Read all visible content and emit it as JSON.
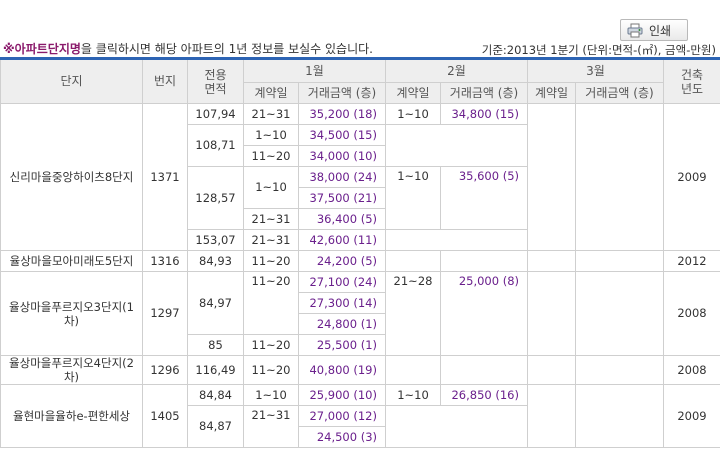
{
  "header": {
    "print_label": "인쇄",
    "notice_highlight": "※아파트단지명",
    "notice_rest": "을 클릭하시면 해당 아파트의 1년 정보를 보실수 있습니다.",
    "basis": "기준:2013년 1분기   (단위:면적-(㎡), 금액-만원)"
  },
  "table": {
    "headers": {
      "complex": "단지",
      "lot": "번지",
      "area": "전용면적",
      "built": "건축년도",
      "months": [
        "1월",
        "2월",
        "3월"
      ],
      "contract_date": "계약일",
      "amount": "거래금액 (층)"
    },
    "complexes": [
      {
        "name": "신리마을중앙하이츠8단지",
        "lot": "1371",
        "built": "2009"
      },
      {
        "name": "율상마을모아미래도5단지",
        "lot": "1316",
        "built": "2012"
      },
      {
        "name": "율상마을푸르지오3단지(1차)",
        "lot": "1297",
        "built": "2008"
      },
      {
        "name": "율상마을푸르지오4단지(2차)",
        "lot": "1296",
        "built": "2008"
      },
      {
        "name": "율현마을율하e-편한세상",
        "lot": "1405",
        "built": "2009"
      }
    ],
    "areas": [
      "107,94",
      "108,71",
      "128,57",
      "153,07",
      "84,93",
      "84,97",
      "85",
      "116,49",
      "84,84",
      "84,87"
    ],
    "rows": [
      {
        "d1": "21~31",
        "a1": "35,200 (18)",
        "d2": "1~10",
        "a2": "34,800 (15)"
      },
      {
        "d1": "1~10",
        "a1": "34,500 (15)"
      },
      {
        "d1": "11~20",
        "a1": "34,000 (10)"
      },
      {
        "d1": "1~10",
        "a1": "38,000 (24)",
        "d2": "1~10",
        "a2": "35,600 (5)"
      },
      {
        "a1": "37,500 (21)"
      },
      {
        "d1": "21~31",
        "a1": "36,400 (5)"
      },
      {
        "d1": "21~31",
        "a1": "42,600 (11)"
      },
      {
        "d1": "11~20",
        "a1": "24,200 (5)"
      },
      {
        "d1": "11~20",
        "a1": "27,100 (24)",
        "d2": "21~28",
        "a2": "25,000 (8)"
      },
      {
        "a1": "27,300 (14)"
      },
      {
        "a1": "24,800 (1)"
      },
      {
        "d1": "11~20",
        "a1": "25,500 (1)"
      },
      {
        "d1": "11~20",
        "a1": "40,800 (19)"
      },
      {
        "d1": "1~10",
        "a1": "25,900 (10)",
        "d2": "1~10",
        "a2": "26,850 (16)"
      },
      {
        "d1": "21~31",
        "a1": "27,000 (12)"
      },
      {
        "a1": "24,500 (3)"
      }
    ]
  }
}
